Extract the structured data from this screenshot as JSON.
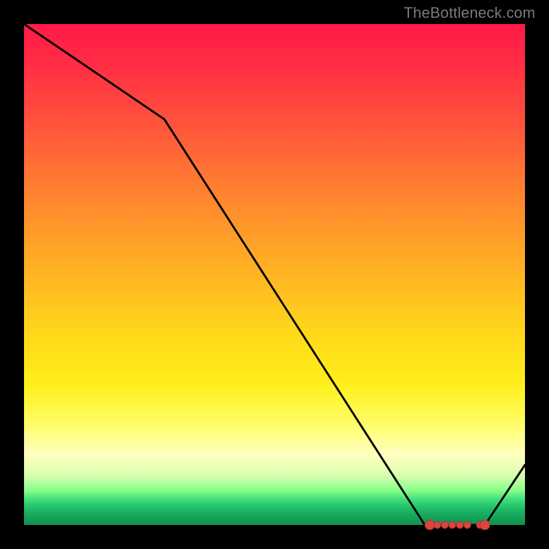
{
  "attribution": "TheBottleneck.com",
  "chart_data": {
    "type": "line",
    "title": "",
    "xlabel": "",
    "ylabel": "",
    "xlim": [
      0,
      100
    ],
    "ylim": [
      0,
      100
    ],
    "x": [
      0,
      28,
      80,
      83,
      92,
      100
    ],
    "values": [
      100,
      81,
      0,
      0,
      0,
      12
    ],
    "markers": {
      "x": [
        81,
        82.5,
        84,
        85.5,
        87,
        88.5,
        91,
        92
      ],
      "values": [
        0,
        0,
        0,
        0,
        0,
        0,
        0,
        0
      ],
      "size": [
        7,
        5,
        5,
        5,
        5,
        5,
        5,
        7
      ]
    }
  }
}
